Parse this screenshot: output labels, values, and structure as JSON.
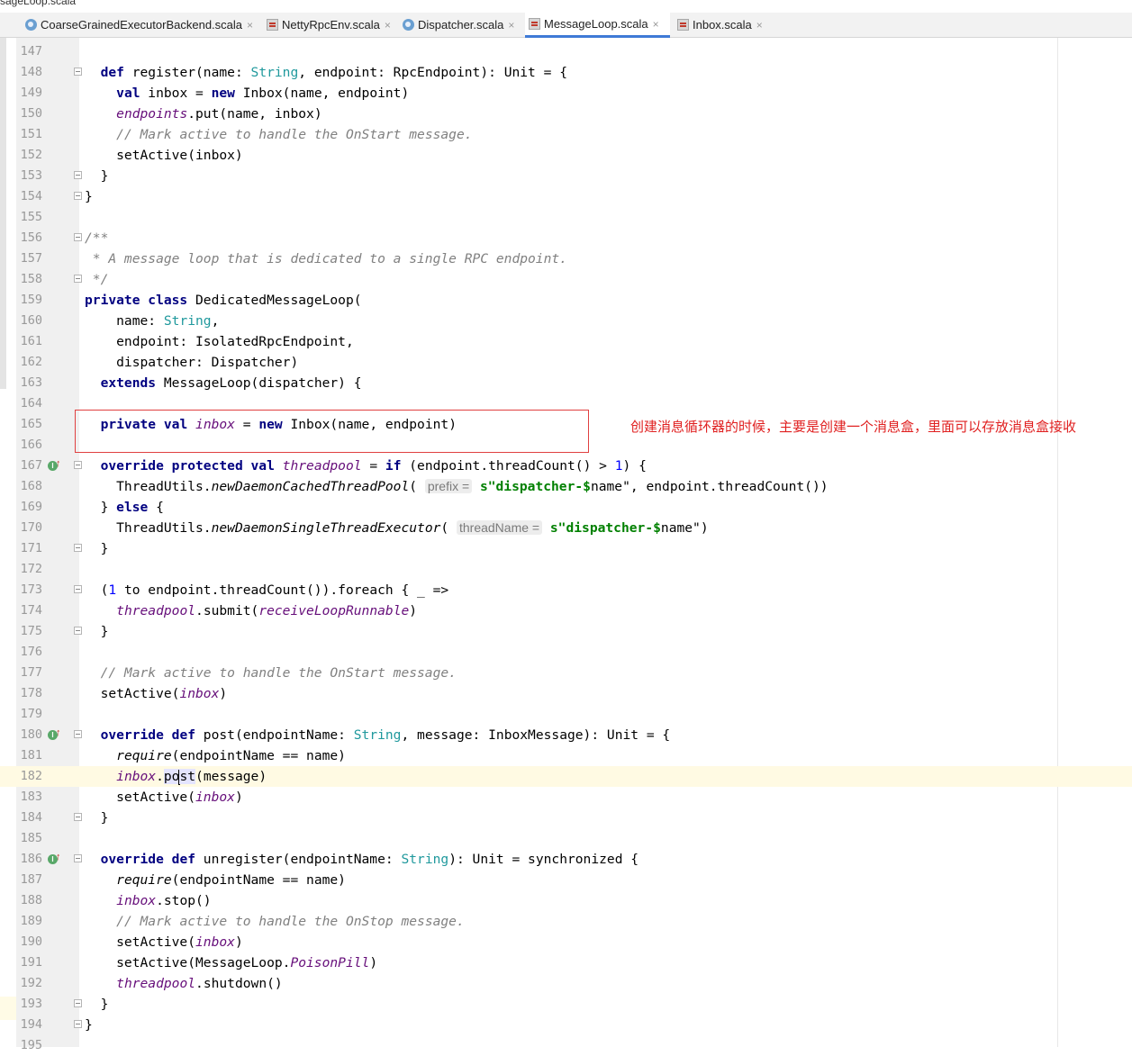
{
  "window": {
    "title_fragment": "ssageLoop.scala"
  },
  "tabs": [
    {
      "label": "CoarseGrainedExecutorBackend.scala",
      "icon": "scala-object-icon",
      "active": false
    },
    {
      "label": "NettyRpcEnv.scala",
      "icon": "scala-class-icon",
      "active": false
    },
    {
      "label": "Dispatcher.scala",
      "icon": "scala-object-icon",
      "active": false
    },
    {
      "label": "MessageLoop.scala",
      "icon": "scala-class-icon",
      "active": true
    },
    {
      "label": "Inbox.scala",
      "icon": "scala-class-icon",
      "active": false
    }
  ],
  "tab_close_glyph": "×",
  "annotation": {
    "text": "创建消息循环器的时候，主要是创建一个消息盒，里面可以存放消息盒接收"
  },
  "editor": {
    "caret_line": 182,
    "lines": [
      {
        "n": 147,
        "segs": []
      },
      {
        "n": 148,
        "fold": true,
        "segs": [
          [
            "",
            "  "
          ],
          [
            "k",
            "def"
          ],
          [
            "",
            " register(name: "
          ],
          [
            "t",
            "String"
          ],
          [
            "",
            ", endpoint: RpcEndpoint): Unit = {"
          ]
        ]
      },
      {
        "n": 149,
        "segs": [
          [
            "",
            "    "
          ],
          [
            "k",
            "val"
          ],
          [
            "",
            " inbox = "
          ],
          [
            "k",
            "new"
          ],
          [
            "",
            " Inbox(name, endpoint)"
          ]
        ]
      },
      {
        "n": 150,
        "segs": [
          [
            "",
            "    "
          ],
          [
            "f",
            "endpoints"
          ],
          [
            "",
            ".put(name, inbox)"
          ]
        ]
      },
      {
        "n": 151,
        "segs": [
          [
            "",
            "    "
          ],
          [
            "c",
            "// Mark active to handle the OnStart message."
          ]
        ]
      },
      {
        "n": 152,
        "segs": [
          [
            "",
            "    setActive(inbox)"
          ]
        ]
      },
      {
        "n": 153,
        "fold": true,
        "segs": [
          [
            "",
            "  }"
          ]
        ]
      },
      {
        "n": 154,
        "fold": true,
        "segs": [
          [
            "",
            "}"
          ]
        ]
      },
      {
        "n": 155,
        "segs": []
      },
      {
        "n": 156,
        "fold": true,
        "segs": [
          [
            "c",
            "/**"
          ]
        ]
      },
      {
        "n": 157,
        "segs": [
          [
            "c",
            " * A message loop that is dedicated to a single RPC endpoint."
          ]
        ]
      },
      {
        "n": 158,
        "fold": true,
        "segs": [
          [
            "c",
            " */"
          ]
        ]
      },
      {
        "n": 159,
        "segs": [
          [
            "k",
            "private class"
          ],
          [
            "",
            " DedicatedMessageLoop("
          ]
        ]
      },
      {
        "n": 160,
        "segs": [
          [
            "",
            "    name: "
          ],
          [
            "t",
            "String"
          ],
          [
            "",
            ","
          ]
        ]
      },
      {
        "n": 161,
        "segs": [
          [
            "",
            "    endpoint: IsolatedRpcEndpoint,"
          ]
        ]
      },
      {
        "n": 162,
        "segs": [
          [
            "",
            "    dispatcher: Dispatcher)"
          ]
        ]
      },
      {
        "n": 163,
        "segs": [
          [
            "",
            "  "
          ],
          [
            "k",
            "extends"
          ],
          [
            "",
            " MessageLoop(dispatcher) {"
          ]
        ]
      },
      {
        "n": 164,
        "segs": []
      },
      {
        "n": 165,
        "segs": [
          [
            "",
            "  "
          ],
          [
            "k",
            "private val"
          ],
          [
            "",
            " "
          ],
          [
            "f",
            "inbox"
          ],
          [
            "",
            " = "
          ],
          [
            "k",
            "new"
          ],
          [
            "",
            " Inbox(name, endpoint)"
          ]
        ]
      },
      {
        "n": 166,
        "segs": []
      },
      {
        "n": 167,
        "fold": true,
        "override": true,
        "segs": [
          [
            "",
            "  "
          ],
          [
            "k",
            "override protected val"
          ],
          [
            "",
            " "
          ],
          [
            "f",
            "threadpool"
          ],
          [
            "",
            " = "
          ],
          [
            "k",
            "if"
          ],
          [
            "",
            " (endpoint.threadCount() > "
          ],
          [
            "n",
            "1"
          ],
          [
            "",
            ") {"
          ]
        ]
      },
      {
        "n": 168,
        "segs": [
          [
            "",
            "    ThreadUtils."
          ],
          [
            "i",
            "newDaemonCachedThreadPool"
          ],
          [
            "",
            "( "
          ],
          [
            "hint",
            "prefix ="
          ],
          [
            "",
            " "
          ],
          [
            "s",
            "s\"dispatcher-$"
          ],
          [
            "",
            "name\", endpoint.threadCount())"
          ]
        ]
      },
      {
        "n": 169,
        "segs": [
          [
            "",
            "  } "
          ],
          [
            "k",
            "else"
          ],
          [
            "",
            " {"
          ]
        ]
      },
      {
        "n": 170,
        "segs": [
          [
            "",
            "    ThreadUtils."
          ],
          [
            "i",
            "newDaemonSingleThreadExecutor"
          ],
          [
            "",
            "( "
          ],
          [
            "hint",
            "threadName ="
          ],
          [
            "",
            " "
          ],
          [
            "s",
            "s\"dispatcher-$"
          ],
          [
            "",
            "name\")"
          ]
        ]
      },
      {
        "n": 171,
        "fold": true,
        "segs": [
          [
            "",
            "  }"
          ]
        ]
      },
      {
        "n": 172,
        "segs": []
      },
      {
        "n": 173,
        "fold": true,
        "segs": [
          [
            "",
            "  ("
          ],
          [
            "n",
            "1"
          ],
          [
            "",
            " to endpoint.threadCount()).foreach { _ =>"
          ]
        ]
      },
      {
        "n": 174,
        "segs": [
          [
            "",
            "    "
          ],
          [
            "f",
            "threadpool"
          ],
          [
            "",
            ".submit("
          ],
          [
            "f",
            "receiveLoopRunnable"
          ],
          [
            "",
            ")"
          ]
        ]
      },
      {
        "n": 175,
        "fold": true,
        "segs": [
          [
            "",
            "  }"
          ]
        ]
      },
      {
        "n": 176,
        "segs": []
      },
      {
        "n": 177,
        "segs": [
          [
            "",
            "  "
          ],
          [
            "c",
            "// Mark active to handle the OnStart message."
          ]
        ]
      },
      {
        "n": 178,
        "segs": [
          [
            "",
            "  setActive("
          ],
          [
            "f",
            "inbox"
          ],
          [
            "",
            ")"
          ]
        ]
      },
      {
        "n": 179,
        "segs": []
      },
      {
        "n": 180,
        "fold": true,
        "override": true,
        "segs": [
          [
            "",
            "  "
          ],
          [
            "k",
            "override def"
          ],
          [
            "",
            " post(endpointName: "
          ],
          [
            "t",
            "String"
          ],
          [
            "",
            ", message: InboxMessage): Unit = {"
          ]
        ]
      },
      {
        "n": 181,
        "segs": [
          [
            "",
            "    "
          ],
          [
            "i",
            "require"
          ],
          [
            "",
            "(endpointName == name)"
          ]
        ]
      },
      {
        "n": 182,
        "segs": [
          [
            "",
            "    "
          ],
          [
            "f",
            "inbox"
          ],
          [
            "",
            "."
          ],
          [
            "hl",
            "po"
          ],
          [
            "cursor",
            ""
          ],
          [
            "hl",
            "st"
          ],
          [
            "",
            "(message)"
          ]
        ]
      },
      {
        "n": 183,
        "segs": [
          [
            "",
            "    setActive("
          ],
          [
            "f",
            "inbox"
          ],
          [
            "",
            ")"
          ]
        ]
      },
      {
        "n": 184,
        "fold": true,
        "segs": [
          [
            "",
            "  }"
          ]
        ]
      },
      {
        "n": 185,
        "segs": []
      },
      {
        "n": 186,
        "fold": true,
        "override": true,
        "segs": [
          [
            "",
            "  "
          ],
          [
            "k",
            "override def"
          ],
          [
            "",
            " unregister(endpointName: "
          ],
          [
            "t",
            "String"
          ],
          [
            "",
            "): Unit = synchronized {"
          ]
        ]
      },
      {
        "n": 187,
        "segs": [
          [
            "",
            "    "
          ],
          [
            "i",
            "require"
          ],
          [
            "",
            "(endpointName == name)"
          ]
        ]
      },
      {
        "n": 188,
        "segs": [
          [
            "",
            "    "
          ],
          [
            "f",
            "inbox"
          ],
          [
            "",
            ".stop()"
          ]
        ]
      },
      {
        "n": 189,
        "segs": [
          [
            "",
            "    "
          ],
          [
            "c",
            "// Mark active to handle the OnStop message."
          ]
        ]
      },
      {
        "n": 190,
        "segs": [
          [
            "",
            "    setActive("
          ],
          [
            "f",
            "inbox"
          ],
          [
            "",
            ")"
          ]
        ]
      },
      {
        "n": 191,
        "segs": [
          [
            "",
            "    setActive(MessageLoop."
          ],
          [
            "f",
            "PoisonPill"
          ],
          [
            "",
            ")"
          ]
        ]
      },
      {
        "n": 192,
        "segs": [
          [
            "",
            "    "
          ],
          [
            "f",
            "threadpool"
          ],
          [
            "",
            ".shutdown()"
          ]
        ]
      },
      {
        "n": 193,
        "fold": true,
        "segs": [
          [
            "",
            "  }"
          ]
        ]
      },
      {
        "n": 194,
        "fold": true,
        "segs": [
          [
            "",
            "}"
          ]
        ]
      },
      {
        "n": 195,
        "segs": []
      }
    ]
  }
}
